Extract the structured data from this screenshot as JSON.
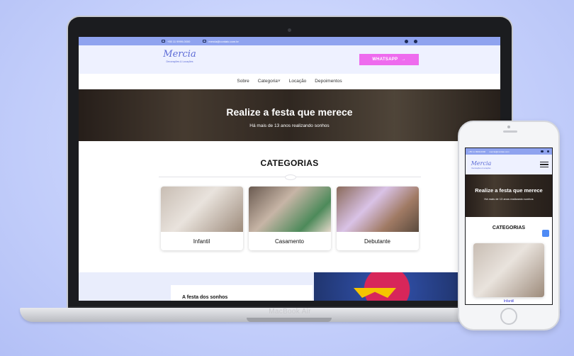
{
  "device": {
    "laptop_label": "MacBook Air"
  },
  "site": {
    "topbar": {
      "phone": "+55 11 9999-0000",
      "email": "mercia@contato.com.br"
    },
    "logo": {
      "name": "Mercia",
      "tagline": "Decorações & Locações"
    },
    "whatsapp_label": "WHATSAPP",
    "nav": [
      "Sobre",
      "Categoria",
      "Locação",
      "Depoimentos"
    ],
    "hero": {
      "title": "Realize a festa que merece",
      "subtitle": "Há mais de 13 anos realizando sonhos"
    },
    "categories_title": "CATEGORIAS",
    "categories": [
      "Infantil",
      "Casamento",
      "Debutante"
    ],
    "banner_heading": "A festa dos sonhos"
  },
  "phone": {
    "topbar": {
      "phone": "+55 11 9999-0000",
      "email": "mercia@contato.com"
    },
    "logo": {
      "name": "Mercia",
      "tagline": "Decorações & Locações"
    },
    "hero": {
      "title": "Realize a festa que merece",
      "subtitle": "Há mais de 13 anos realizando sonhos"
    },
    "categories_title": "CATEGORIAS",
    "first_category": "Infantil"
  },
  "colors": {
    "accent": "#8fa3ef",
    "whatsapp": "#ee6bee",
    "brand": "#5b6ad6"
  }
}
